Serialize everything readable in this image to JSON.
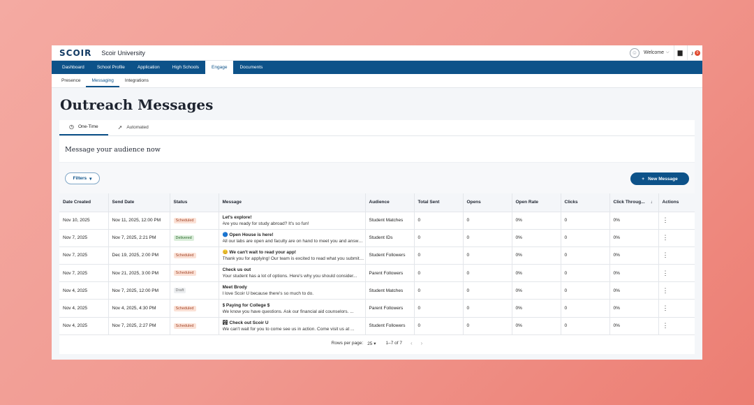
{
  "header": {
    "logo": "SCOIR",
    "university": "Scoir University",
    "welcome": "Welcome",
    "notif_count": "0"
  },
  "main_nav": [
    "Dashboard",
    "School Profile",
    "Application",
    "High Schools",
    "Engage",
    "Documents"
  ],
  "main_nav_active": "Engage",
  "sub_nav": [
    "Presence",
    "Messaging",
    "Integrations"
  ],
  "sub_nav_active": "Messaging",
  "page_title": "Outreach Messages",
  "tabs": {
    "one_time": "One-Time",
    "automated": "Automated"
  },
  "section_title": "Message your audience now",
  "filters_label": "Filters",
  "new_message_label": "New Message",
  "columns": [
    "Date Created",
    "Send Date",
    "Status",
    "Message",
    "Audience",
    "Total Sent",
    "Opens",
    "Open Rate",
    "Clicks",
    "Click Throug...",
    "Actions"
  ],
  "rows": [
    {
      "created": "Nov 10, 2025",
      "send": "Nov 11, 2025, 12:00 PM",
      "status": "Scheduled",
      "title": "Let's explore!",
      "body": "Are you ready for study abroad? It's so fun!",
      "audience": "Student Matches",
      "sent": "0",
      "opens": "0",
      "open_rate": "0%",
      "clicks": "0",
      "ctr": "0%"
    },
    {
      "created": "Nov 7, 2025",
      "send": "Nov 7, 2025, 2:21 PM",
      "status": "Delivered",
      "title": "🔵 Open House is here!",
      "body": "All our labs are open and faculty are on hand to meet you and answer...",
      "audience": "Student IDs",
      "sent": "0",
      "opens": "0",
      "open_rate": "0%",
      "clicks": "0",
      "ctr": "0%"
    },
    {
      "created": "Nov 7, 2025",
      "send": "Dec 19, 2025, 2:00 PM",
      "status": "Scheduled",
      "title": "😊 We can't wait to read your app!",
      "body": "Thank you for applying! Our team is excited to read what you submitted...",
      "audience": "Student Followers",
      "sent": "0",
      "opens": "0",
      "open_rate": "0%",
      "clicks": "0",
      "ctr": "0%"
    },
    {
      "created": "Nov 7, 2025",
      "send": "Nov 21, 2025, 3:00 PM",
      "status": "Scheduled",
      "title": "Check us out",
      "body": "Your student has a lot of options. Here's why you should consider...",
      "audience": "Parent Followers",
      "sent": "0",
      "opens": "0",
      "open_rate": "0%",
      "clicks": "0",
      "ctr": "0%"
    },
    {
      "created": "Nov 4, 2025",
      "send": "Nov 7, 2025, 12:00 PM",
      "status": "Draft",
      "title": "Meet Brody",
      "body": "I love Scoir U because there's so much to do.",
      "audience": "Student Matches",
      "sent": "0",
      "opens": "0",
      "open_rate": "0%",
      "clicks": "0",
      "ctr": "0%"
    },
    {
      "created": "Nov 4, 2025",
      "send": "Nov 4, 2025, 4:30 PM",
      "status": "Scheduled",
      "title": "$ Paying for College $",
      "body": "We know you have questions. Ask our financial aid counselors. ...",
      "audience": "Parent Followers",
      "sent": "0",
      "opens": "0",
      "open_rate": "0%",
      "clicks": "0",
      "ctr": "0%"
    },
    {
      "created": "Nov 4, 2025",
      "send": "Nov 7, 2025, 2:27 PM",
      "status": "Scheduled",
      "title": "🏞 Check out Scoir U",
      "body": "We can't wait for you to come see us in action. Come visit us at ...",
      "audience": "Student Followers",
      "sent": "0",
      "opens": "0",
      "open_rate": "0%",
      "clicks": "0",
      "ctr": "0%"
    }
  ],
  "pagination": {
    "rows_label": "Rows per page:",
    "rows_value": "25",
    "range": "1–7 of 7"
  }
}
